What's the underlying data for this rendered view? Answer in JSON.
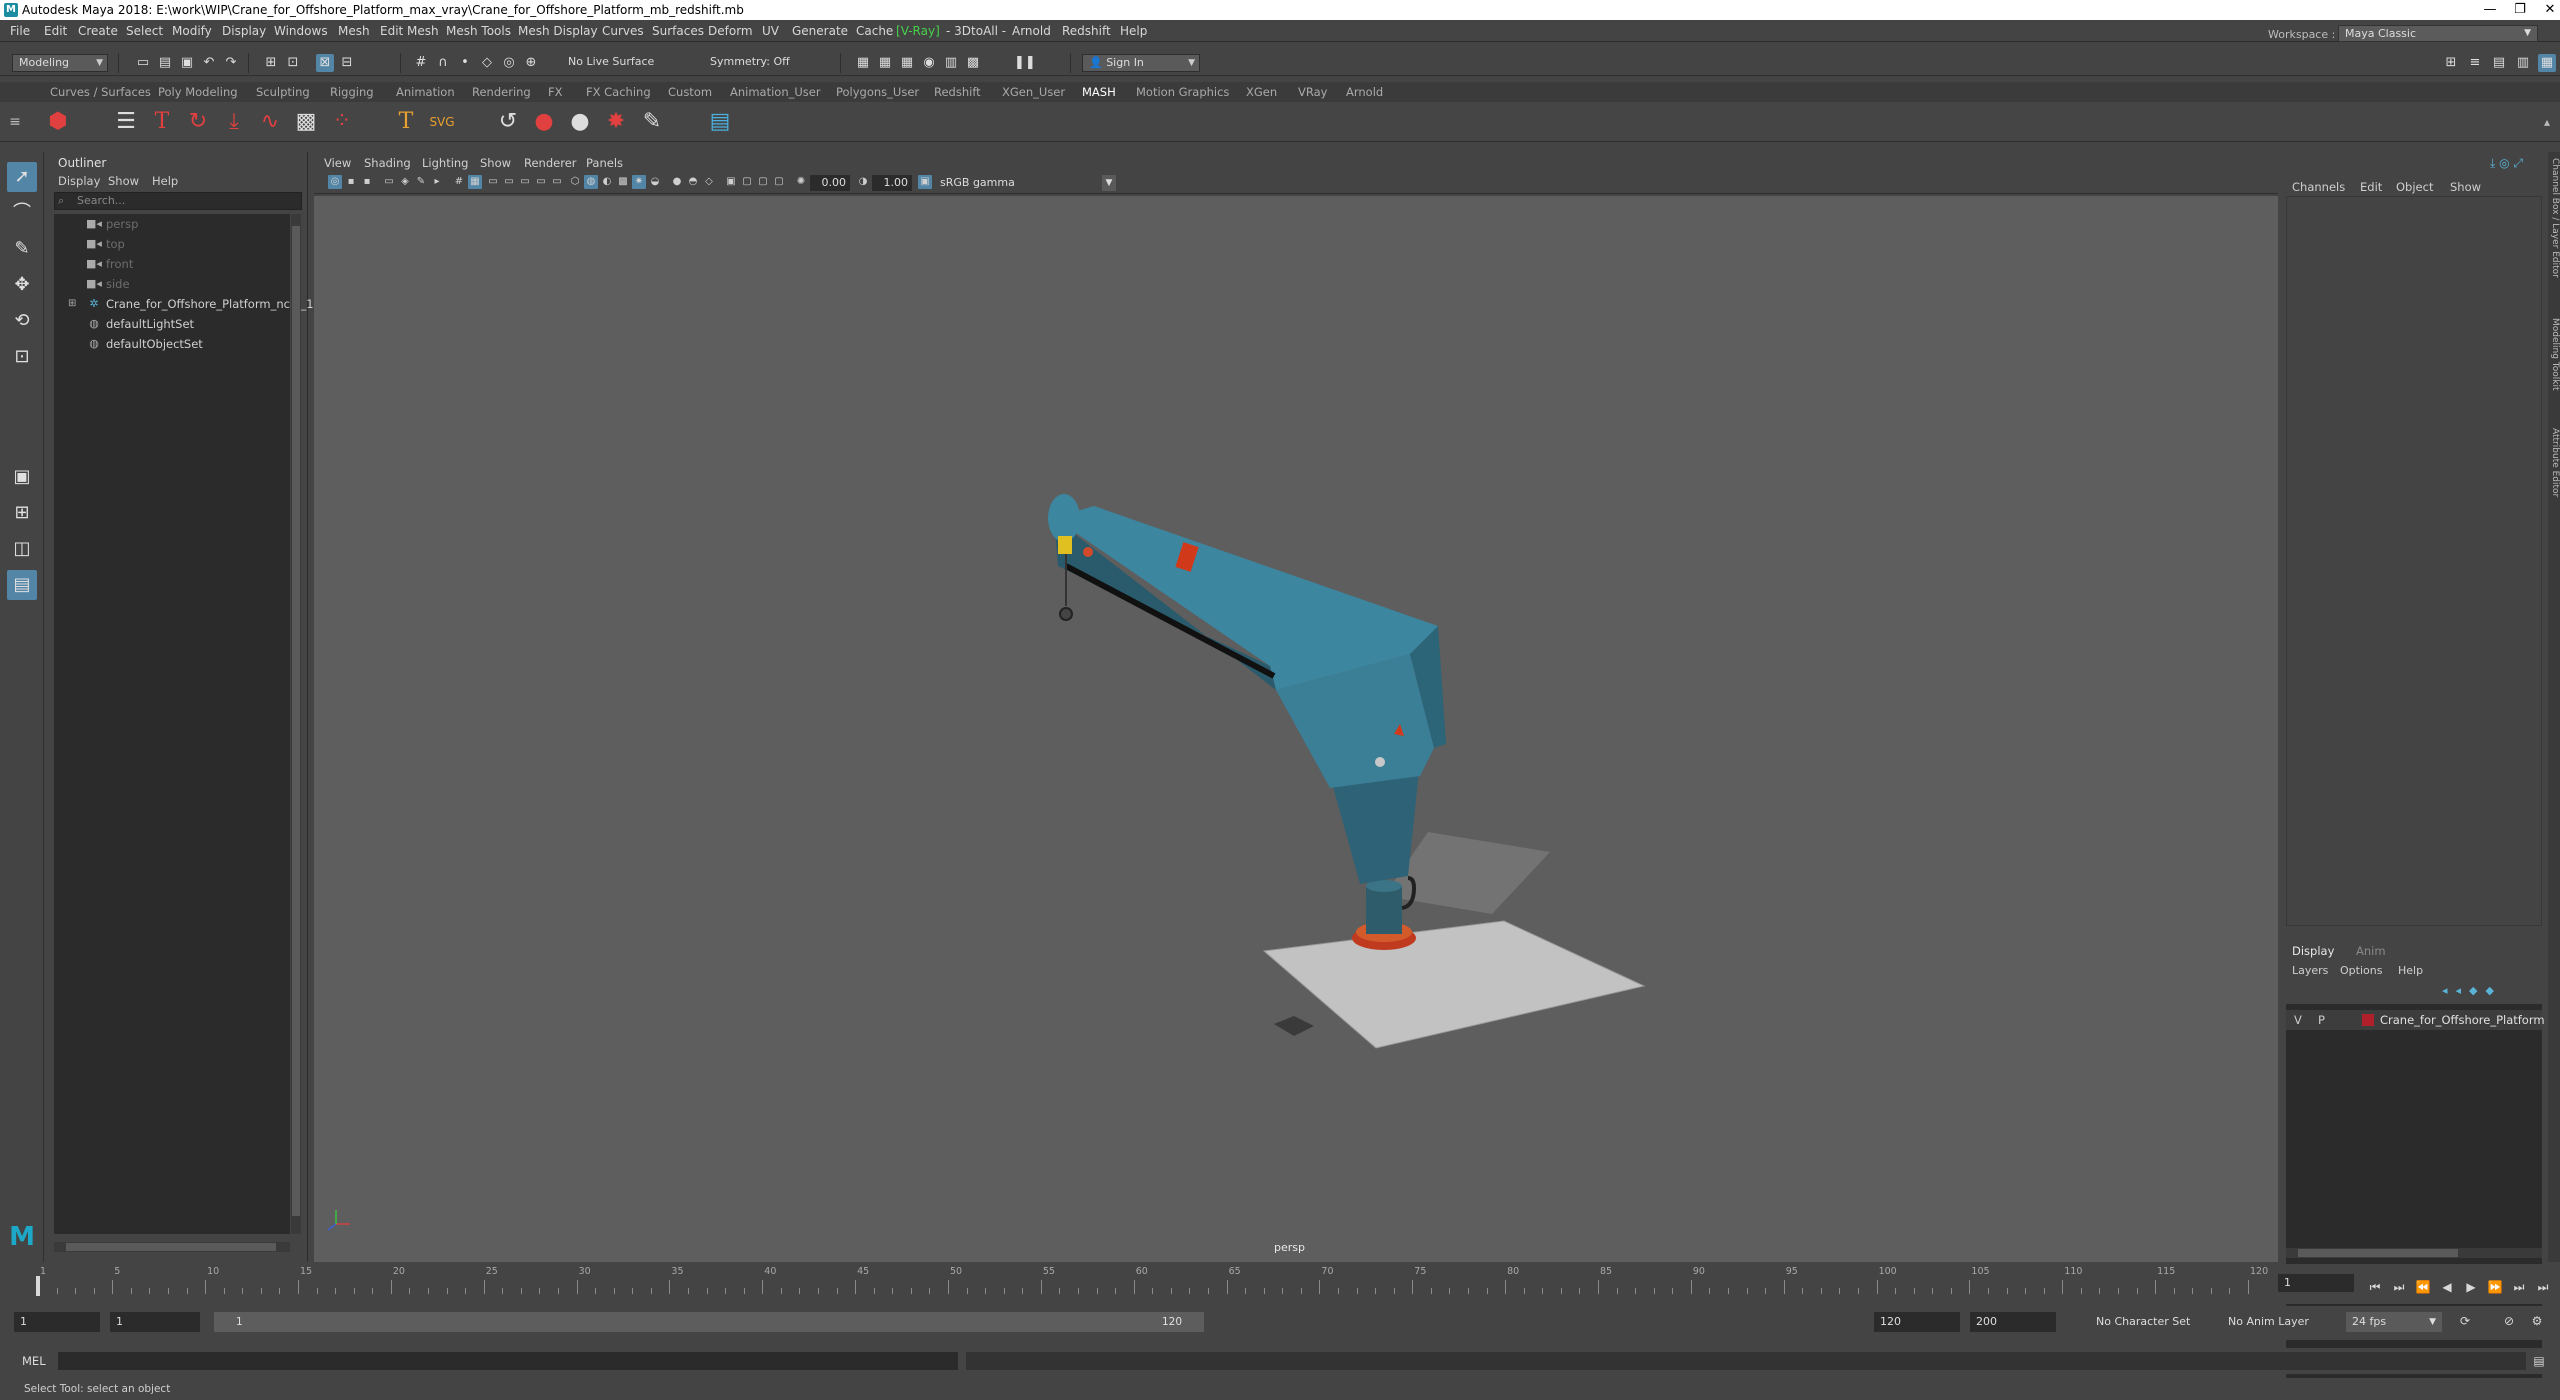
{
  "titlebar": {
    "title": "Autodesk Maya 2018: E:\\work\\WIP\\Crane_for_Offshore_Platform_max_vray\\Crane_for_Offshore_Platform_mb_redshift.mb",
    "minimize": "—",
    "maximize": "❐",
    "close": "✕"
  },
  "menubar": {
    "items": [
      "File",
      "Edit",
      "Create",
      "Select",
      "Modify",
      "Display",
      "Windows",
      "Mesh",
      "Edit Mesh",
      "Mesh Tools",
      "Mesh Display",
      "Curves",
      "Surfaces",
      "Deform",
      "UV",
      "Generate",
      "Cache",
      "V-Ray",
      "- 3DtoAll -",
      "Arnold",
      "Redshift",
      "Help"
    ],
    "workspace_label": "Workspace :",
    "workspace_value": "Maya Classic"
  },
  "statusline": {
    "mode": "Modeling",
    "live_surface": "No Live Surface",
    "symmetry": "Symmetry: Off",
    "sign_in": "Sign In"
  },
  "shelf": {
    "tabs": [
      "Curves / Surfaces",
      "Poly Modeling",
      "Sculpting",
      "Rigging",
      "Animation",
      "Rendering",
      "FX",
      "FX Caching",
      "Custom",
      "Animation_User",
      "Polygons_User",
      "Redshift",
      "XGen_User",
      "MASH",
      "Motion Graphics",
      "XGen",
      "VRay",
      "Arnold"
    ],
    "active_tab": "MASH"
  },
  "outliner": {
    "title": "Outliner",
    "menu": [
      "Display",
      "Show",
      "Help"
    ],
    "search_placeholder": "Search...",
    "items": [
      {
        "label": "persp",
        "dim": true
      },
      {
        "label": "top",
        "dim": true
      },
      {
        "label": "front",
        "dim": true
      },
      {
        "label": "side",
        "dim": true
      },
      {
        "label": "Crane_for_Offshore_Platform_ncl1_1",
        "dim": false
      },
      {
        "label": "defaultLightSet",
        "dim": false
      },
      {
        "label": "defaultObjectSet",
        "dim": false
      }
    ]
  },
  "viewport": {
    "menu": [
      "View",
      "Shading",
      "Lighting",
      "Show",
      "Renderer",
      "Panels"
    ],
    "exposure": "0.00",
    "gamma": "1.00",
    "color_space": "sRGB gamma",
    "camera_label": "persp"
  },
  "channelbox": {
    "menu": [
      "Channels",
      "Edit",
      "Object",
      "Show"
    ],
    "layer_tabs": [
      "Display",
      "Anim"
    ],
    "layer_menu": [
      "Layers",
      "Options",
      "Help"
    ],
    "layer": {
      "v": "V",
      "p": "P",
      "name": "Crane_for_Offshore_Platform",
      "color": "#b0202a"
    },
    "side_tabs": [
      "Channel Box / Layer Editor",
      "Modeling Toolkit",
      "Attribute Editor"
    ]
  },
  "timeslider": {
    "ticks": [
      1,
      5,
      10,
      15,
      20,
      25,
      30,
      35,
      40,
      45,
      50,
      55,
      60,
      65,
      70,
      75,
      80,
      85,
      90,
      95,
      100,
      105,
      110,
      115,
      120
    ],
    "current_frame": "1"
  },
  "rangeslider": {
    "start": "1",
    "playback_start": "1",
    "range_left": "1",
    "range_right": "120",
    "playback_end": "120",
    "end": "200",
    "character_set": "No Character Set",
    "anim_layer": "No Anim Layer",
    "fps": "24 fps"
  },
  "cmdline": {
    "label": "MEL",
    "help": "Select Tool: select an object"
  }
}
